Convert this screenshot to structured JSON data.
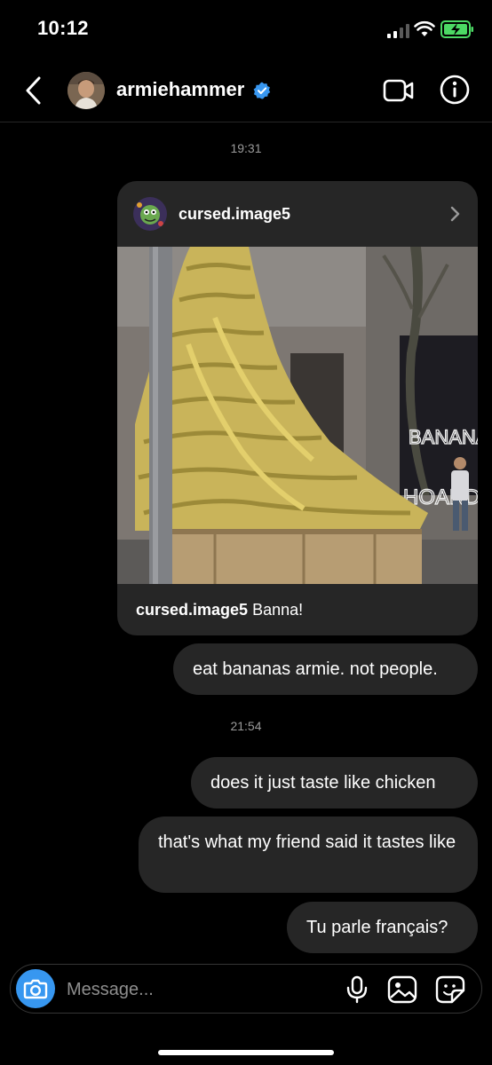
{
  "status_bar": {
    "time": "10:12",
    "signal_icon": "cellular-signal-icon",
    "wifi_icon": "wifi-icon",
    "battery_icon": "battery-charging-icon",
    "battery_color": "#4cd964"
  },
  "header": {
    "username": "armiehammer",
    "verified_color": "#3897f0",
    "back_icon": "chevron-left-icon",
    "video_icon": "video-camera-icon",
    "info_icon": "info-icon"
  },
  "thread": {
    "timestamp_1": "19:31",
    "shared_post": {
      "author": "cursed.image5",
      "caption_author": "cursed.image5",
      "caption_text": "Banna!",
      "sign_line_1": "BANANA",
      "sign_line_2": "HOARD"
    },
    "message_1": "eat bananas armie. not people.",
    "timestamp_2": "21:54",
    "message_2": "does it just taste like chicken",
    "message_3": "that's what my friend said it tastes like",
    "message_4": "Tu parle français?"
  },
  "composer": {
    "placeholder": "Message...",
    "camera_icon": "camera-icon",
    "mic_icon": "microphone-icon",
    "gallery_icon": "image-gallery-icon",
    "sticker_icon": "sticker-icon",
    "accent_color": "#3797f0"
  }
}
